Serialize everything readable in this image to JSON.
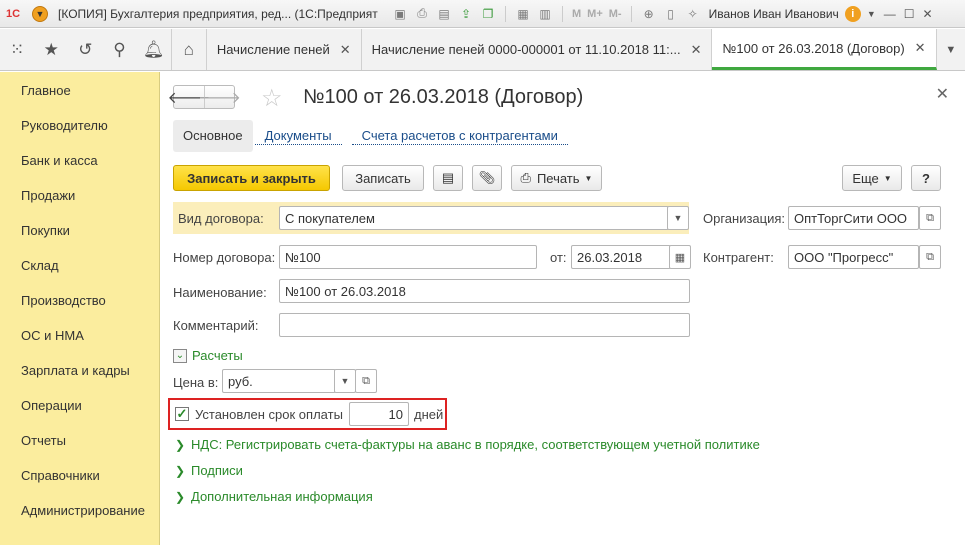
{
  "window": {
    "logo": "1С",
    "title": "[КОПИЯ] Бухгалтерия предприятия, ред... (1С:Предприятие)",
    "m_label": "M",
    "m_plus_label": "M+",
    "m_minus_label": "M-",
    "user": "Иванов Иван Иванович"
  },
  "tabs": [
    {
      "label": "Начисление пеней"
    },
    {
      "label": "Начисление пеней 0000-000001 от 11.10.2018 11:..."
    },
    {
      "label": "№100 от 26.03.2018 (Договор)"
    }
  ],
  "sidebar": {
    "items": [
      {
        "label": "Главное"
      },
      {
        "label": "Руководителю"
      },
      {
        "label": "Банк и касса"
      },
      {
        "label": "Продажи"
      },
      {
        "label": "Покупки"
      },
      {
        "label": "Склад"
      },
      {
        "label": "Производство"
      },
      {
        "label": "ОС и НМА"
      },
      {
        "label": "Зарплата и кадры"
      },
      {
        "label": "Операции"
      },
      {
        "label": "Отчеты"
      },
      {
        "label": "Справочники"
      },
      {
        "label": "Администрирование"
      }
    ]
  },
  "form": {
    "title": "№100 от 26.03.2018 (Договор)",
    "subtabs": [
      {
        "label": "Основное"
      },
      {
        "label": "Документы"
      },
      {
        "label": "Счета расчетов с контрагентами"
      }
    ],
    "toolbar": {
      "save_close": "Записать и закрыть",
      "save": "Записать",
      "print": "Печать",
      "more": "Еще",
      "help": "?"
    },
    "fields": {
      "contract_type_label": "Вид договора:",
      "contract_type_value": "С покупателем",
      "organization_label": "Организация:",
      "organization_value": "ОптТоргСити ООО",
      "number_label": "Номер договора:",
      "number_value": "№100",
      "date_label": "от:",
      "date_value": "26.03.2018",
      "counterparty_label": "Контрагент:",
      "counterparty_value": "ООО \"Прогресс\"",
      "name_label": "Наименование:",
      "name_value": "№100 от 26.03.2018",
      "comment_label": "Комментарий:",
      "comment_value": ""
    },
    "settlements": {
      "title": "Расчеты",
      "price_label": "Цена в:",
      "price_value": "руб.",
      "payterm_label": "Установлен срок оплаты",
      "payterm_days": "10",
      "payterm_unit": "дней"
    },
    "sections": [
      {
        "label": "НДС: Регистрировать счета-фактуры на аванс в порядке, соответствующем учетной политике"
      },
      {
        "label": "Подписи"
      },
      {
        "label": "Дополнительная информация"
      }
    ]
  }
}
